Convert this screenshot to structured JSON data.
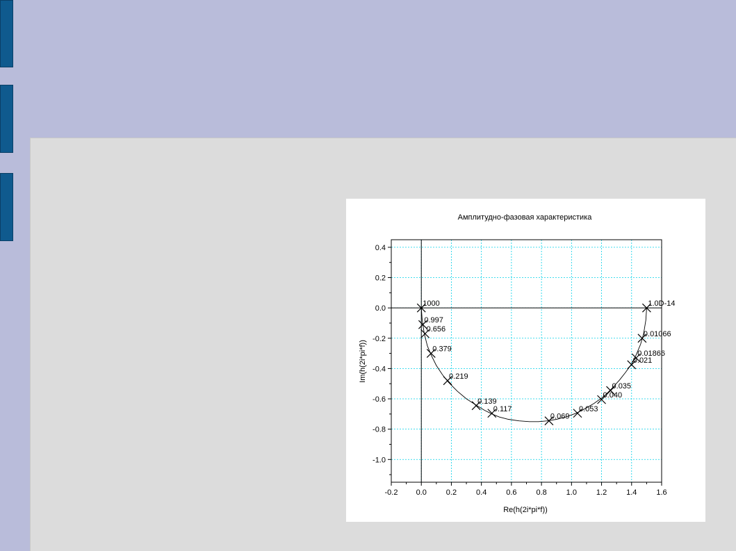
{
  "slide": {
    "tab_count": 3
  },
  "chart_data": {
    "type": "line",
    "title": "Амплитудно-фазовая характеристика",
    "xlabel": "Re(h(2i*pi*f))",
    "ylabel": "Im(h(2i*pi*f))",
    "xlim": [
      -0.2,
      1.6
    ],
    "ylim": [
      -1.15,
      0.45
    ],
    "xticks": [
      -0.2,
      0.0,
      0.2,
      0.4,
      0.6,
      0.8,
      1.0,
      1.2,
      1.4,
      1.6
    ],
    "xtick_labels": [
      "-0.2",
      "0.0",
      "0.2",
      "0.4",
      "0.6",
      "0.8",
      "1.0",
      "1.2",
      "1.4",
      "1.6"
    ],
    "yticks": [
      0.4,
      0.2,
      0.0,
      -0.2,
      -0.4,
      -0.6,
      -0.8,
      -1.0
    ],
    "ytick_labels": [
      "0.4",
      "0.2",
      "0.0",
      "-0.2",
      "-0.4",
      "-0.6",
      "-0.8",
      "-1.0"
    ],
    "grid": true,
    "grid_color": "#00d0e8",
    "curve": {
      "x": [
        0.0,
        0.005,
        0.012,
        0.02,
        0.04,
        0.065,
        0.1,
        0.14,
        0.18,
        0.24,
        0.3,
        0.37,
        0.42,
        0.47,
        0.52,
        0.58,
        0.65,
        0.72,
        0.78,
        0.84,
        0.9,
        0.96,
        1.03,
        1.09,
        1.15,
        1.2,
        1.24,
        1.28,
        1.32,
        1.36,
        1.4,
        1.43,
        1.46,
        1.48,
        1.495,
        1.5
      ],
      "y": [
        0.0,
        -0.07,
        -0.12,
        -0.17,
        -0.25,
        -0.31,
        -0.38,
        -0.44,
        -0.49,
        -0.55,
        -0.6,
        -0.645,
        -0.675,
        -0.7,
        -0.72,
        -0.735,
        -0.745,
        -0.75,
        -0.75,
        -0.745,
        -0.735,
        -0.72,
        -0.695,
        -0.665,
        -0.63,
        -0.595,
        -0.56,
        -0.52,
        -0.475,
        -0.425,
        -0.37,
        -0.31,
        -0.24,
        -0.17,
        -0.08,
        0.0
      ]
    },
    "markers": [
      {
        "x": 0.0,
        "y": 0.0,
        "label": "1000"
      },
      {
        "x": 0.01,
        "y": -0.11,
        "label": "0.997"
      },
      {
        "x": 0.025,
        "y": -0.17,
        "label": "0.656"
      },
      {
        "x": 0.065,
        "y": -0.3,
        "label": "0.379"
      },
      {
        "x": 0.175,
        "y": -0.48,
        "label": "0.219"
      },
      {
        "x": 0.365,
        "y": -0.645,
        "label": "0.139"
      },
      {
        "x": 0.47,
        "y": -0.695,
        "label": "0.117"
      },
      {
        "x": 0.85,
        "y": -0.745,
        "label": "0.069"
      },
      {
        "x": 1.04,
        "y": -0.695,
        "label": "0.053"
      },
      {
        "x": 1.2,
        "y": -0.605,
        "label": "0.040"
      },
      {
        "x": 1.26,
        "y": -0.545,
        "label": "0.035"
      },
      {
        "x": 1.4,
        "y": -0.375,
        "label": "0.021"
      },
      {
        "x": 1.43,
        "y": -0.33,
        "label": "0.01866"
      },
      {
        "x": 1.47,
        "y": -0.2,
        "label": "0.01066"
      },
      {
        "x": 1.5,
        "y": 0.0,
        "label": "1.0D-14"
      }
    ]
  }
}
